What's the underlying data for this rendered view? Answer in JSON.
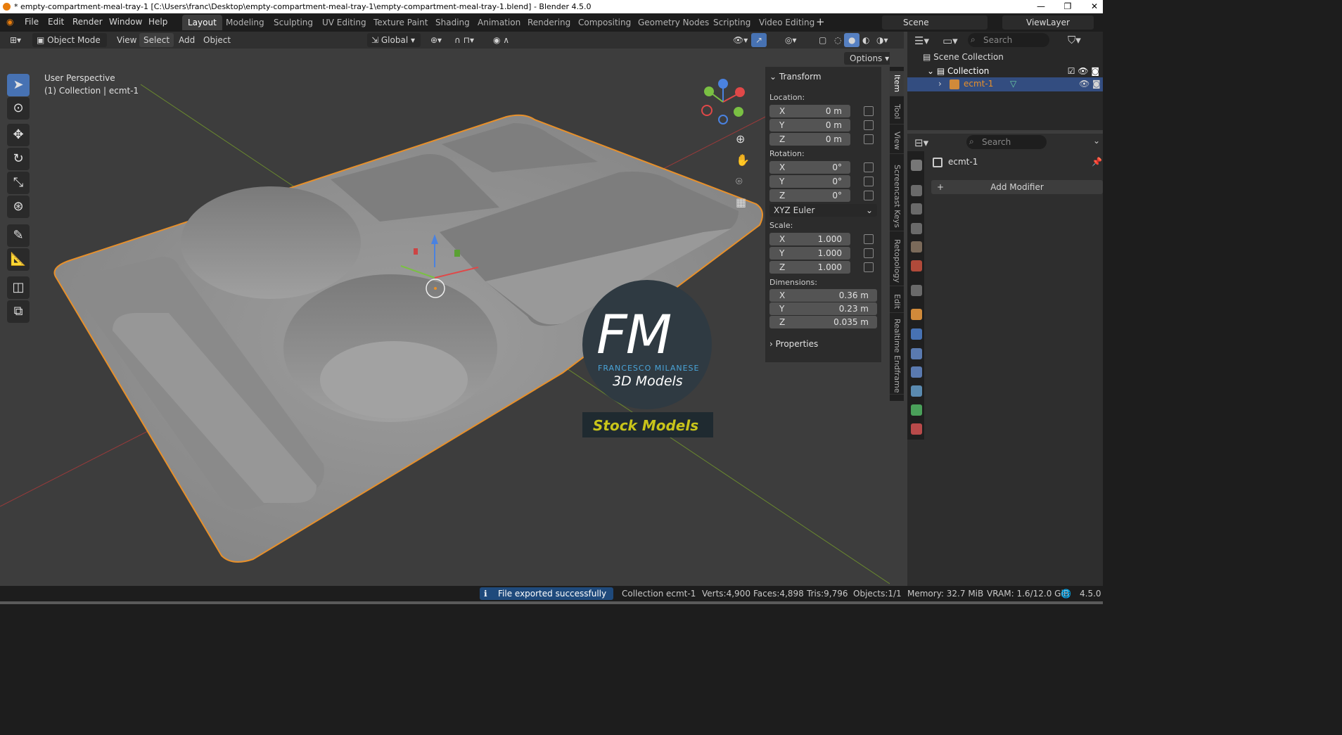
{
  "window": {
    "title": "* empty-compartment-meal-tray-1 [C:\\Users\\franc\\Desktop\\empty-compartment-meal-tray-1\\empty-compartment-meal-tray-1.blend] - Blender 4.5.0"
  },
  "menus": [
    "File",
    "Edit",
    "Render",
    "Window",
    "Help"
  ],
  "workspaces": [
    "Layout",
    "Modeling",
    "Sculpting",
    "UV Editing",
    "Texture Paint",
    "Shading",
    "Animation",
    "Rendering",
    "Compositing",
    "Geometry Nodes",
    "Scripting",
    "Video Editing"
  ],
  "active_workspace": "Layout",
  "scene": "Scene",
  "view_layer": "ViewLayer",
  "viewport_header": {
    "mode": "Object Mode",
    "view": "View",
    "select": "Select",
    "add": "Add",
    "object": "Object",
    "orientation": "Global",
    "options": "Options"
  },
  "viewport": {
    "perspective": "User Perspective",
    "collection_info": "(1) Collection | ecmt-1"
  },
  "watermark": {
    "logo": "FM",
    "name": "FRANCESCO MILANESE",
    "sub": "3D Models",
    "banner": "Stock Models"
  },
  "npanel": {
    "transform_title": "Transform",
    "location_label": "Location:",
    "rotation_label": "Rotation:",
    "scale_label": "Scale:",
    "dimensions_label": "Dimensions:",
    "rotation_mode": "XYZ Euler",
    "properties": "Properties",
    "axes": [
      "X",
      "Y",
      "Z"
    ],
    "location": [
      "0 m",
      "0 m",
      "0 m"
    ],
    "rotation": [
      "0°",
      "0°",
      "0°"
    ],
    "scale": [
      "1.000",
      "1.000",
      "1.000"
    ],
    "dimensions": [
      "0.36 m",
      "0.23 m",
      "0.035 m"
    ],
    "tabs": [
      "Item",
      "Tool",
      "View",
      "Screencast Keys",
      "Retopology",
      "Edit",
      "Realtime Endframe"
    ]
  },
  "outliner": {
    "search": "Search",
    "scene_collection": "Scene Collection",
    "collection": "Collection",
    "object": "ecmt-1"
  },
  "properties": {
    "search": "Search",
    "object_name": "ecmt-1",
    "add_modifier": "Add Modifier"
  },
  "status": {
    "notice": "File exported successfully",
    "collection": "Collection",
    "object": "ecmt-1",
    "verts": "Verts:4,900",
    "faces": "Faces:4,898",
    "tris": "Tris:9,796",
    "objects": "Objects:1/1",
    "memory": "Memory: 32.7 MiB",
    "vram": "VRAM: 1.6/12.0 GiB",
    "version": "4.5.0"
  },
  "colors": {
    "accent": "#4772b3",
    "selection": "#e8902a",
    "header": "#1d1d1d",
    "panel": "#2c2c2c"
  }
}
